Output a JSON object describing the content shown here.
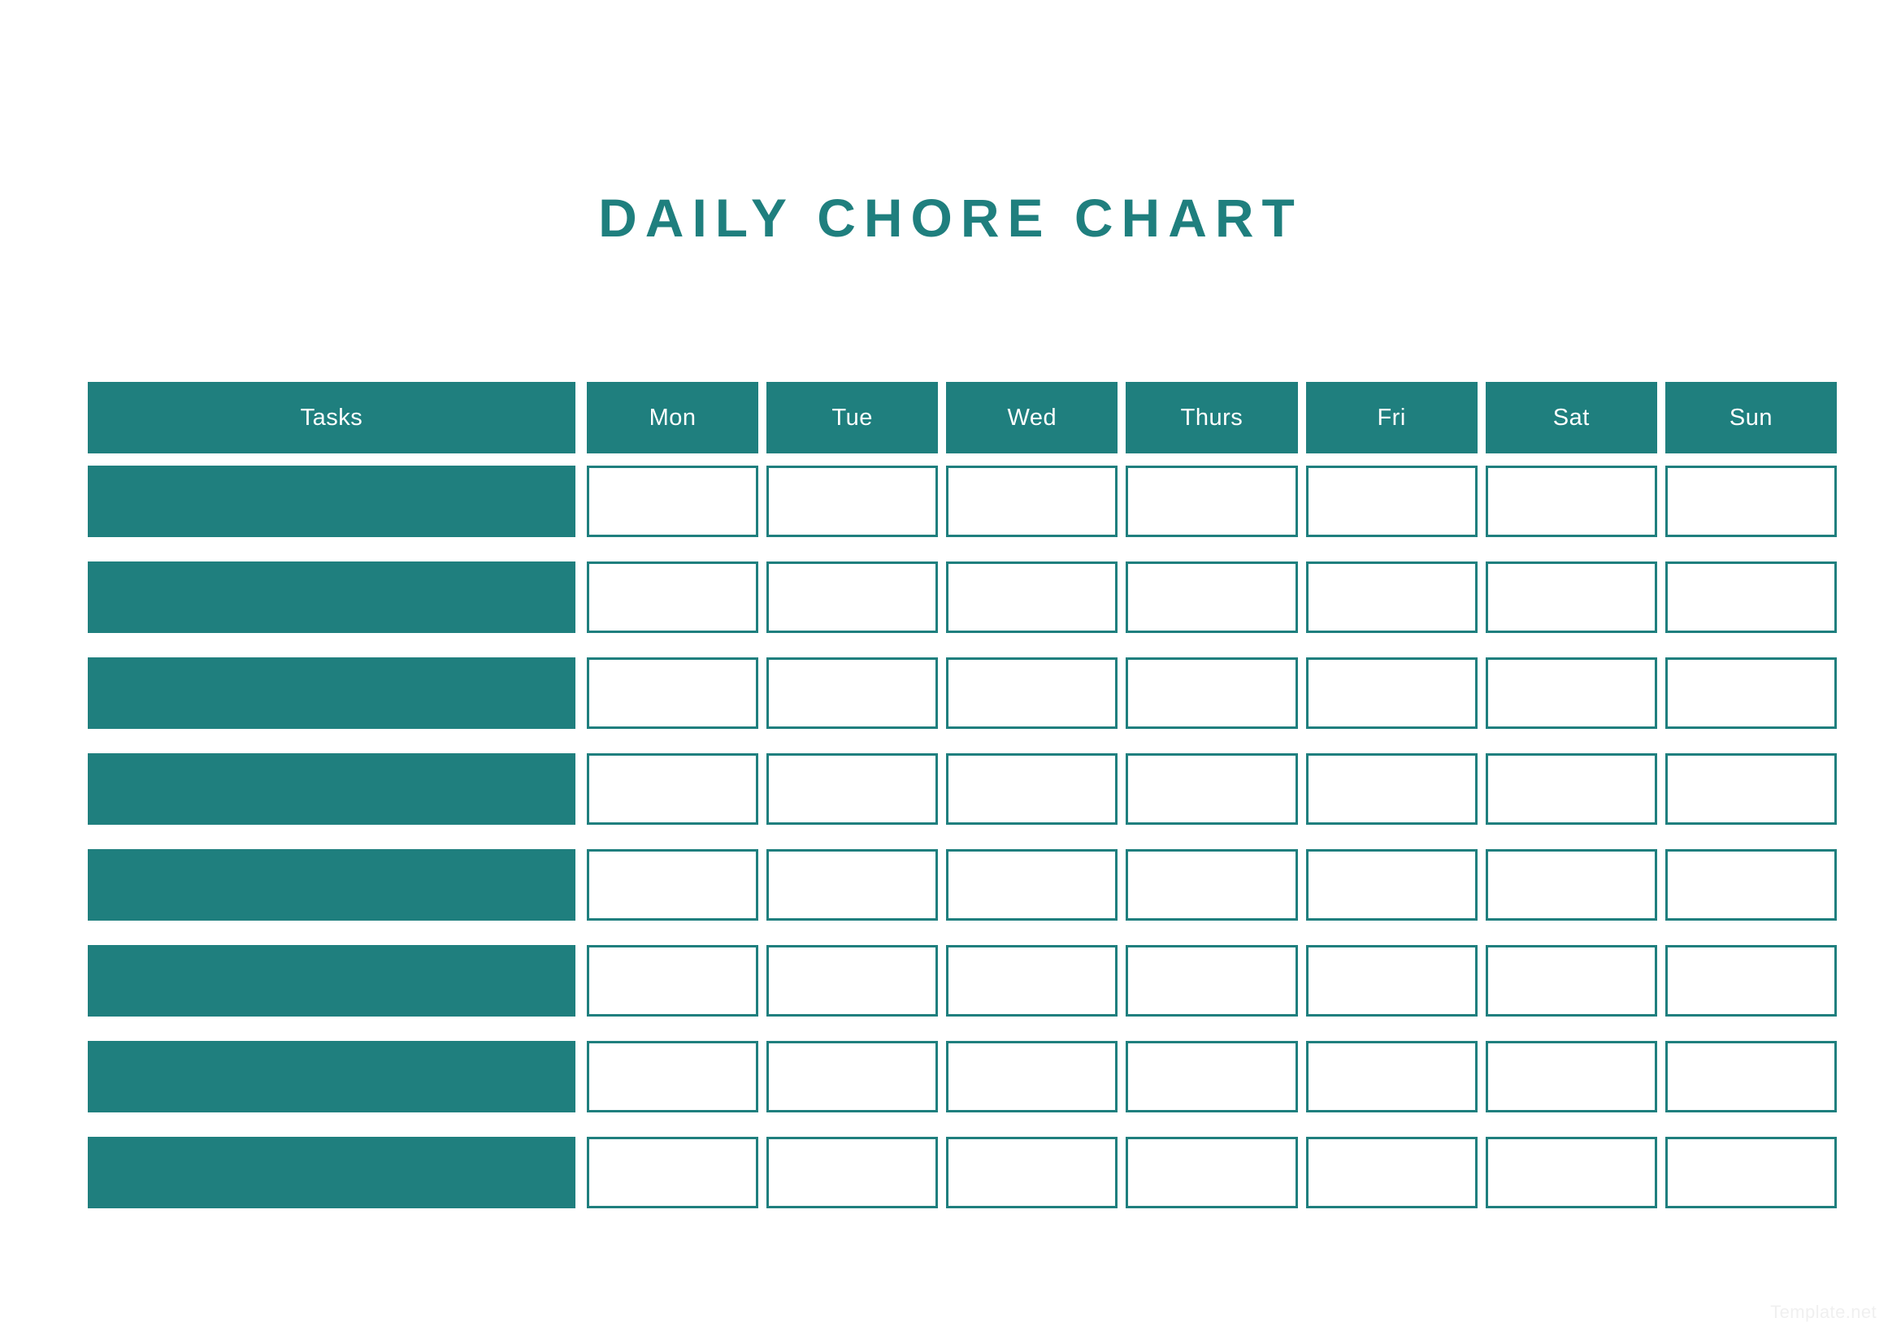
{
  "document": {
    "title": "DAILY CHORE CHART",
    "accent_color": "#1f7f7e",
    "background_color": "#ffffff"
  },
  "table": {
    "task_column_header": "Tasks",
    "day_columns": [
      "Mon",
      "Tue",
      "Wed",
      "Thurs",
      "Fri",
      "Sat",
      "Sun"
    ],
    "rows": [
      {
        "task": "",
        "checks": [
          "",
          "",
          "",
          "",
          "",
          "",
          ""
        ]
      },
      {
        "task": "",
        "checks": [
          "",
          "",
          "",
          "",
          "",
          "",
          ""
        ]
      },
      {
        "task": "",
        "checks": [
          "",
          "",
          "",
          "",
          "",
          "",
          ""
        ]
      },
      {
        "task": "",
        "checks": [
          "",
          "",
          "",
          "",
          "",
          "",
          ""
        ]
      },
      {
        "task": "",
        "checks": [
          "",
          "",
          "",
          "",
          "",
          "",
          ""
        ]
      },
      {
        "task": "",
        "checks": [
          "",
          "",
          "",
          "",
          "",
          "",
          ""
        ]
      },
      {
        "task": "",
        "checks": [
          "",
          "",
          "",
          "",
          "",
          "",
          ""
        ]
      },
      {
        "task": "",
        "checks": [
          "",
          "",
          "",
          "",
          "",
          "",
          ""
        ]
      }
    ],
    "row_count": 8
  },
  "footer": {
    "watermark": "Template.net"
  }
}
